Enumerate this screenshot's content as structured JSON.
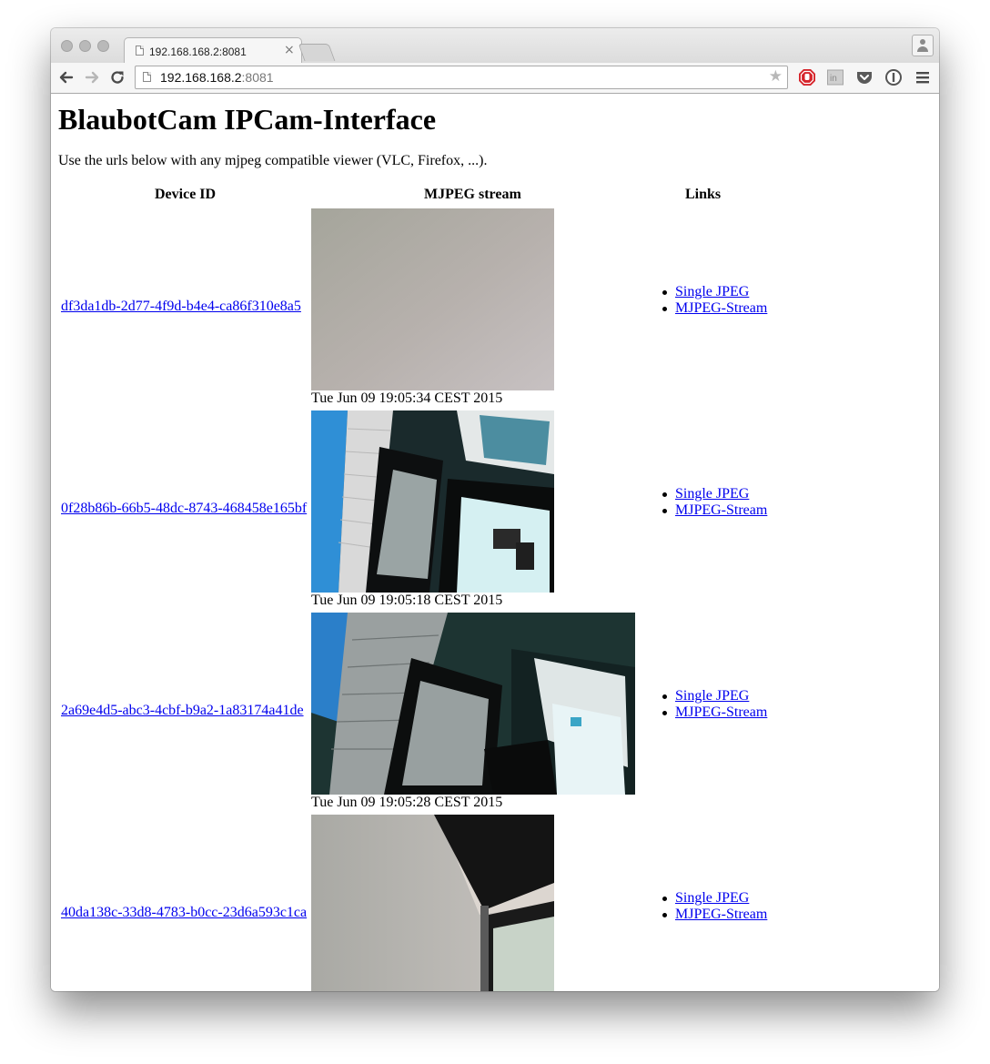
{
  "browser": {
    "tab_title": "192.168.168.2:8081",
    "tab_close": "×",
    "url_host": "192.168.168.2",
    "url_port": ":8081",
    "icons": [
      "back-icon",
      "forward-icon",
      "reload-icon",
      "page-icon",
      "star-icon",
      "adblock-icon",
      "linkedin-icon",
      "pocket-icon",
      "onepassword-icon",
      "menu-icon",
      "profile-icon"
    ]
  },
  "page": {
    "title": "BlaubotCam IPCam-Interface",
    "intro": "Use the urls below with any mjpeg compatible viewer (VLC, Firefox, ...).",
    "headers": {
      "device_id": "Device ID",
      "stream": "MJPEG stream",
      "links": "Links"
    },
    "devices": [
      {
        "id": "df3da1db-2d77-4f9d-b4e4-ca86f310e8a5",
        "timestamp": "Tue Jun 09 19:05:34 CEST 2015",
        "single_jpeg": "Single JPEG",
        "mjpeg_stream": "MJPEG-Stream"
      },
      {
        "id": "0f28b86b-66b5-48dc-8743-468458e165bf",
        "timestamp": "Tue Jun 09 19:05:18 CEST 2015",
        "single_jpeg": "Single JPEG",
        "mjpeg_stream": "MJPEG-Stream"
      },
      {
        "id": "2a69e4d5-abc3-4cbf-b9a2-1a83174a41de",
        "timestamp": "Tue Jun 09 19:05:28 CEST 2015",
        "single_jpeg": "Single JPEG",
        "mjpeg_stream": "MJPEG-Stream"
      },
      {
        "id": "40da138c-33d8-4783-b0cc-23d6a593c1ca",
        "single_jpeg": "Single JPEG",
        "mjpeg_stream": "MJPEG-Stream"
      }
    ]
  }
}
